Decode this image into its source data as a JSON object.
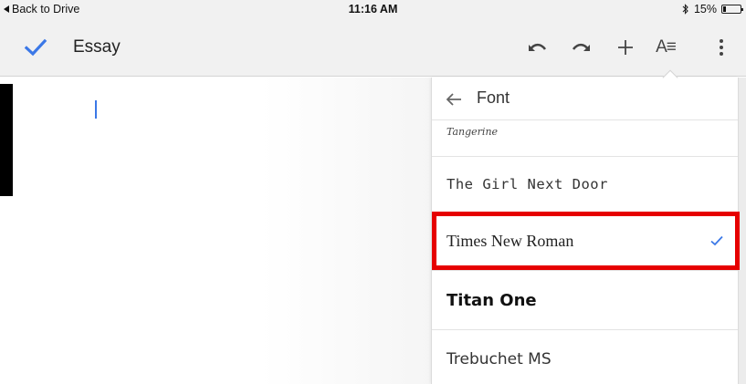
{
  "status_bar": {
    "back_label": "Back to Drive",
    "time": "11:16 AM",
    "battery_text": "15%"
  },
  "toolbar": {
    "document_title": "Essay",
    "format_label": "A≡"
  },
  "font_panel": {
    "title": "Font",
    "fonts": [
      {
        "name": "Tangerine",
        "selected": false
      },
      {
        "name": "The Girl Next Door",
        "selected": false
      },
      {
        "name": "Times New Roman",
        "selected": true
      },
      {
        "name": "Titan One",
        "selected": false
      },
      {
        "name": "Trebuchet MS",
        "selected": false
      }
    ]
  },
  "colors": {
    "accent_blue": "#3b78e7",
    "highlight_red": "#e60000",
    "toolbar_bg": "#f1f1f1"
  },
  "icons": [
    "back-triangle-icon",
    "bluetooth-icon",
    "battery-icon",
    "done-check-icon",
    "undo-icon",
    "redo-icon",
    "insert-plus-icon",
    "text-format-icon",
    "more-vertical-icon",
    "back-arrow-icon",
    "selected-check-icon"
  ]
}
